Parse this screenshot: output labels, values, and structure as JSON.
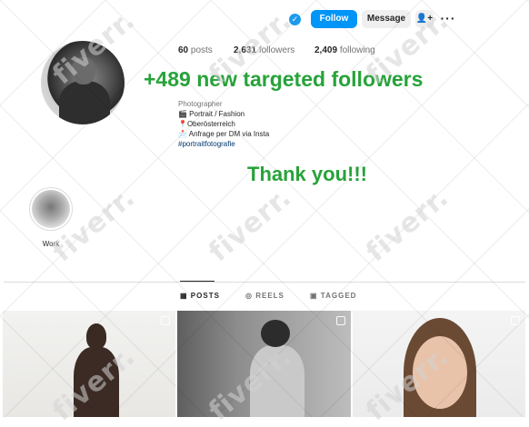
{
  "header": {
    "verified_icon": "✓",
    "follow_label": "Follow",
    "message_label": "Message",
    "suggest_icon": "👤+",
    "more_icon": "···"
  },
  "stats": {
    "posts_count": "60",
    "posts_label": "posts",
    "followers_count": "2,631",
    "followers_label": "followers",
    "following_count": "2,409",
    "following_label": "following"
  },
  "overlay": {
    "promo": "+489 new targeted followers",
    "thanks": "Thank you!!!",
    "accent_color": "#27a33a"
  },
  "bio": {
    "category": "Photographer",
    "line1": "🎬 Portrait / Fashion",
    "line2": "📍Oberösterreich",
    "line3": "📩 Anfrage per DM via Insta",
    "hashtag": "#portraitfotografie"
  },
  "highlights": [
    {
      "label": "Work"
    }
  ],
  "tabs": [
    {
      "label": "POSTS",
      "icon": "grid-icon"
    },
    {
      "label": "REELS",
      "icon": "reels-icon"
    },
    {
      "label": "TAGGED",
      "icon": "tagged-icon"
    }
  ],
  "watermark": "fiverr."
}
